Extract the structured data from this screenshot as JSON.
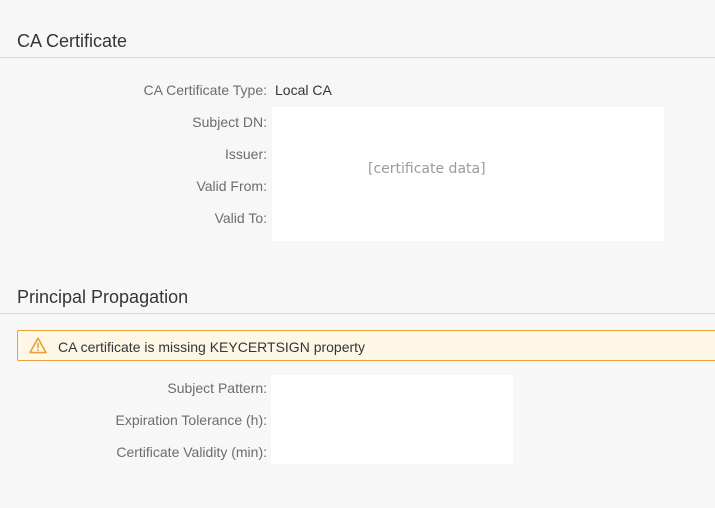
{
  "ca_certificate": {
    "title": "CA Certificate",
    "fields": [
      {
        "label": "CA Certificate Type:",
        "value": "Local CA"
      },
      {
        "label": "Subject DN:"
      },
      {
        "label": "Issuer:"
      },
      {
        "label": "Valid From:"
      },
      {
        "label": "Valid To:"
      }
    ],
    "redacted_placeholder": "[certificate data]"
  },
  "principal_propagation": {
    "title": "Principal Propagation",
    "warning": "CA certificate is missing KEYCERTSIGN property",
    "fields": [
      {
        "label": "Subject Pattern:"
      },
      {
        "label": "Expiration Tolerance (h):"
      },
      {
        "label": "Certificate Validity (min):"
      }
    ]
  },
  "colors": {
    "warning_border": "#e9a23b",
    "warning_background": "#fef7e6",
    "warning_icon": "#e9a23b"
  },
  "icons": {
    "warning": "warning-triangle-icon"
  }
}
